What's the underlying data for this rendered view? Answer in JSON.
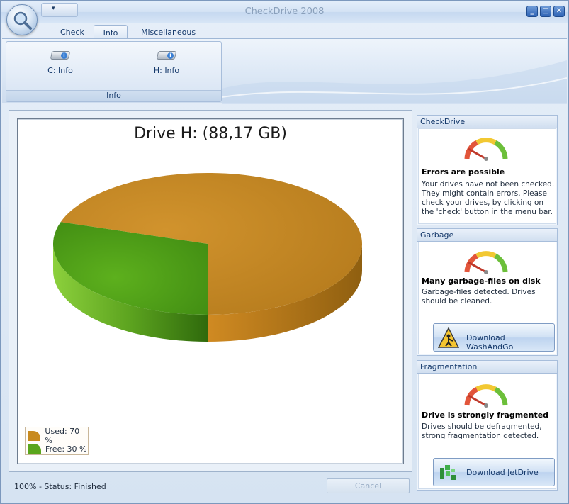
{
  "window": {
    "title": "CheckDrive 2008",
    "qat_glyph": "▾",
    "min_glyph": "_",
    "max_glyph": "□",
    "close_glyph": "✕"
  },
  "tabs": [
    {
      "label": "Check",
      "active": false
    },
    {
      "label": "Info",
      "active": true
    },
    {
      "label": "Miscellaneous",
      "active": false
    }
  ],
  "ribbon": {
    "group_label": "Info",
    "buttons": [
      {
        "label": "C: Info",
        "icon": "drive-info-icon"
      },
      {
        "label": "H: Info",
        "icon": "drive-info-icon"
      }
    ]
  },
  "chart_data": {
    "type": "pie",
    "title": "Drive H: (88,17 GB)",
    "slices": [
      {
        "label": "Used: 70 %",
        "value": 70,
        "color": "#c88a1e"
      },
      {
        "label": "Free: 30 %",
        "value": 30,
        "color": "#5aa61c"
      }
    ],
    "legend_position": "bottom-left"
  },
  "status": {
    "text": "100% - Status: Finished",
    "cancel_label": "Cancel"
  },
  "panels": {
    "checkdrive": {
      "header": "CheckDrive",
      "title": "Errors are possible",
      "text": "Your drives have not been checked. They might contain errors. Please check your drives, by clicking on the 'check' button in the menu bar.",
      "icon": "gauge-icon"
    },
    "garbage": {
      "header": "Garbage",
      "title": "Many garbage-files on disk",
      "text": "Garbage-files detected. Drives should be cleaned.",
      "button_label": "Download WashAndGo",
      "icon": "gauge-icon",
      "button_icon": "washandgo-icon"
    },
    "fragmentation": {
      "header": "Fragmentation",
      "title": "Drive is strongly fragmented",
      "text": "Drives should be defragmented, strong fragmentation detected.",
      "button_label": "Download JetDrive",
      "icon": "gauge-icon",
      "button_icon": "jetdrive-icon"
    }
  },
  "colors": {
    "used": "#c88a1e",
    "free": "#5aa61c",
    "accent": "#15396b"
  }
}
